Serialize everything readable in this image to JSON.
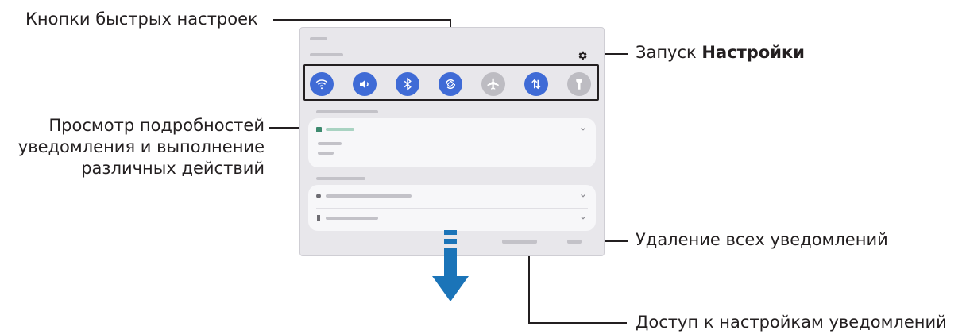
{
  "callouts": {
    "quick_settings": "Кнопки быстрых настроек",
    "launch_settings_prefix": "Запуск ",
    "launch_settings_bold": "Настройки",
    "notification_details_line1": "Просмотр подробностей",
    "notification_details_line2": "уведомления и выполнение",
    "notification_details_line3": "различных действий",
    "clear_all": "Удаление всех уведомлений",
    "notification_settings": "Доступ к настройкам уведомлений"
  },
  "quick_settings_buttons": [
    {
      "icon": "wifi-icon",
      "state": "on"
    },
    {
      "icon": "sound-icon",
      "state": "on"
    },
    {
      "icon": "bluetooth-icon",
      "state": "on"
    },
    {
      "icon": "auto-rotate-icon",
      "state": "on"
    },
    {
      "icon": "airplane-mode-icon",
      "state": "off"
    },
    {
      "icon": "mobile-data-icon",
      "state": "on"
    },
    {
      "icon": "flashlight-icon",
      "state": "off"
    }
  ],
  "colors": {
    "accent": "#3f6bd6",
    "arrow": "#1b74b8",
    "panel": "#e8e7eb",
    "text": "#231f20"
  }
}
